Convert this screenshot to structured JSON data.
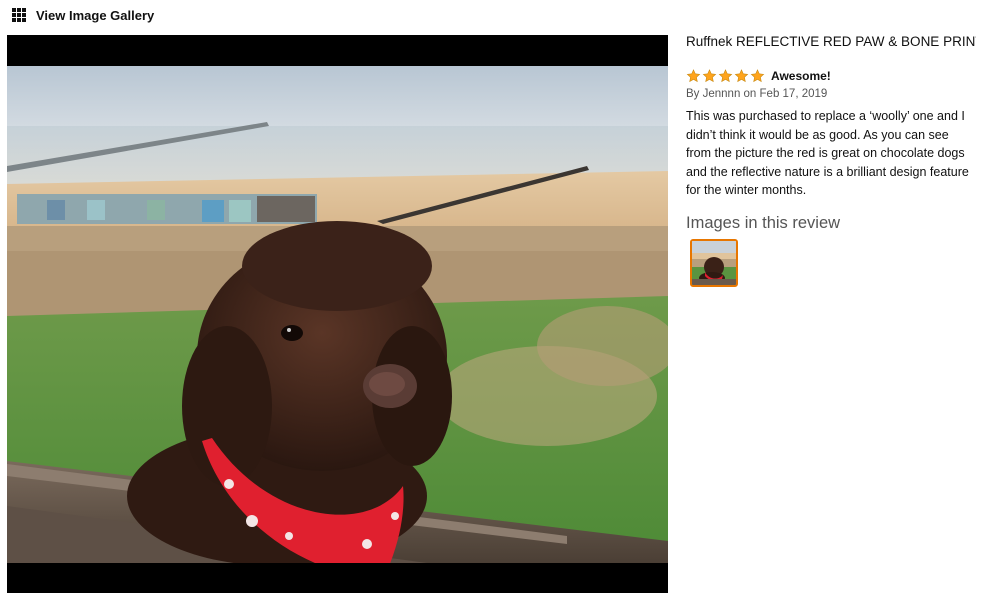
{
  "gallery": {
    "link_label": "View Image Gallery",
    "icon": "grid-icon"
  },
  "review": {
    "product_title": "Ruffnek REFLECTIVE RED PAW & BONE PRINT DOG SCARF/COLLAR/BANDANA BE",
    "rating": 5,
    "rating_max": 5,
    "heading": "Awesome!",
    "byline": "By Jennnn on Feb 17, 2019",
    "body": "This was purchased to replace a ‘woolly’ one and I didn’t think it would be as good. As you can see from the picture the red is great on chocolate dogs and the reflective nature is a brilliant design feature for the winter months."
  },
  "images_section": {
    "heading": "Images in this review",
    "thumbnail_count": 1
  },
  "colors": {
    "star": "#ffa41c",
    "thumbnail_border": "#e77600",
    "viewer_background": "#000000"
  }
}
